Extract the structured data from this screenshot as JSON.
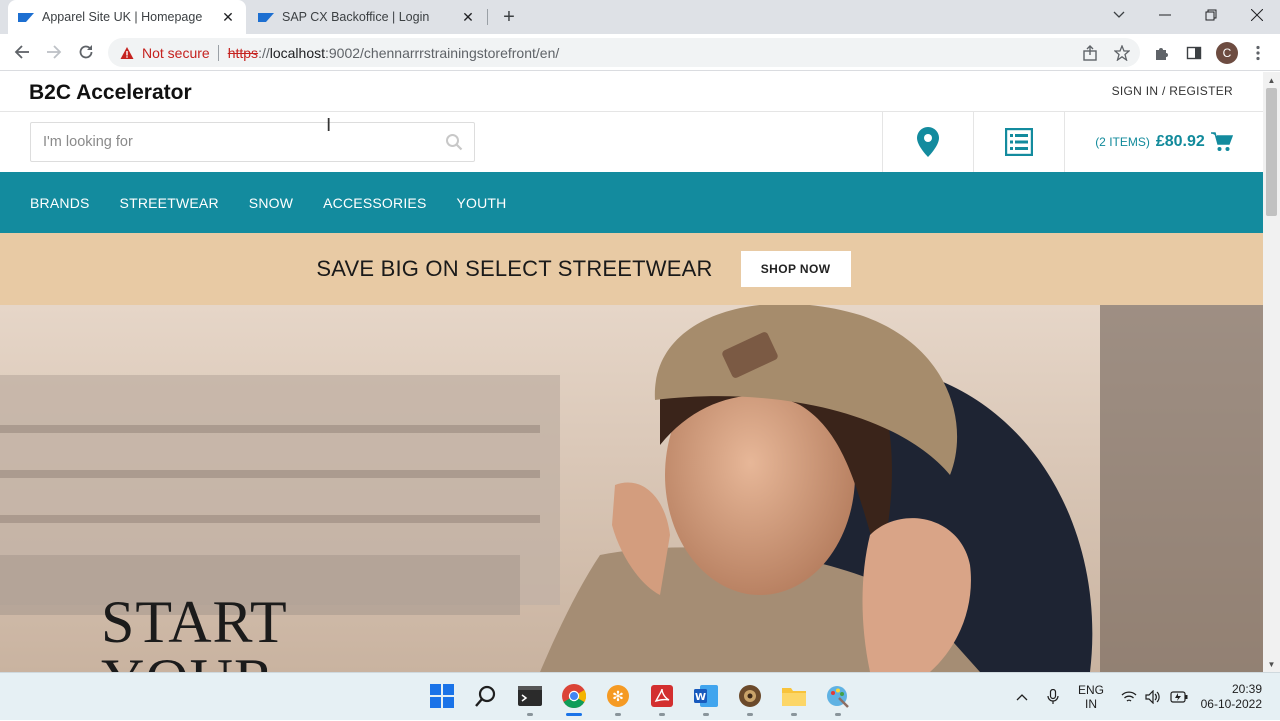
{
  "browser": {
    "tabs": [
      {
        "title": "Apparel Site UK | Homepage",
        "active": true
      },
      {
        "title": "SAP CX Backoffice | Login",
        "active": false
      }
    ],
    "security_label": "Not secure",
    "url_scheme": "https",
    "url_rest": "://",
    "url_host": "localhost",
    "url_path": ":9002/chennarrrstrainingstorefront/en/",
    "profile_initial": "C"
  },
  "site": {
    "brand": "B2C Accelerator",
    "signin_label": "SIGN IN / REGISTER",
    "search_placeholder": "I'm looking for",
    "cart_items": "(2 ITEMS)",
    "cart_total": "£80.92",
    "nav": [
      "BRANDS",
      "STREETWEAR",
      "SNOW",
      "ACCESSORIES",
      "YOUTH"
    ],
    "promo_text": "SAVE BIG ON SELECT STREETWEAR",
    "promo_button": "SHOP NOW",
    "hero_headline_line1": "START",
    "hero_headline_line2": "YOUR"
  },
  "taskbar": {
    "language_line1": "ENG",
    "language_line2": "IN",
    "time": "20:39",
    "date": "06-10-2022"
  },
  "colors": {
    "brand_teal": "#138b9e",
    "promo_bg": "#e8caa4",
    "not_secure_red": "#c5221f"
  }
}
